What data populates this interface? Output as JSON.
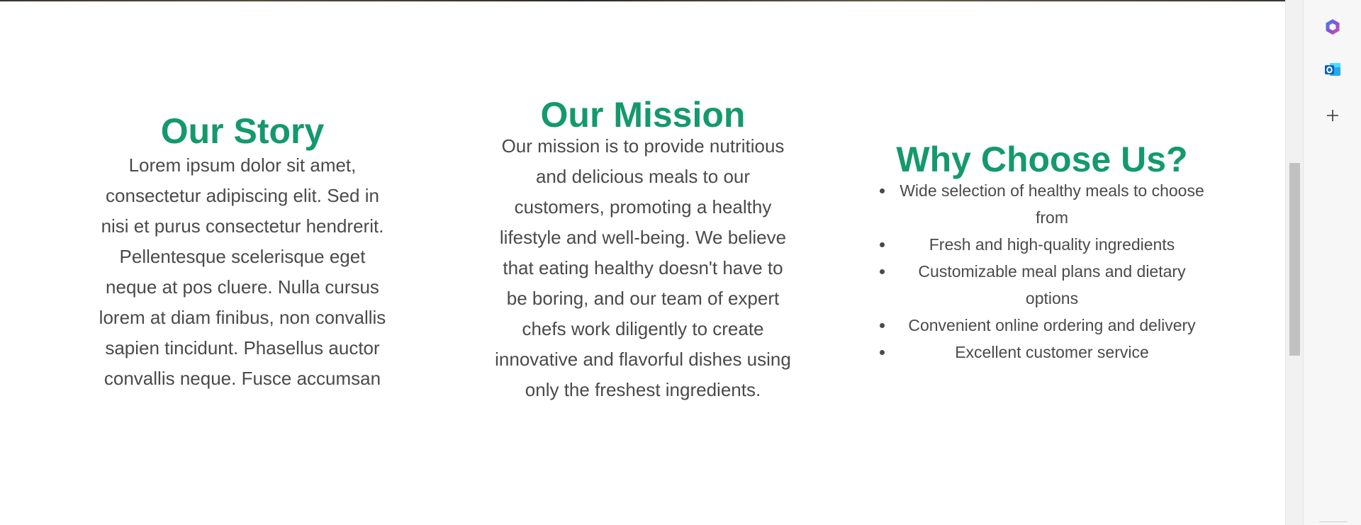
{
  "story": {
    "title": "Our Story",
    "text": "Lorem ipsum dolor sit amet, consectetur adipiscing elit. Sed in nisi et purus consectetur hendrerit. Pellentesque scelerisque eget neque at pos cluere. Nulla cursus lorem at diam finibus, non convallis sapien tincidunt. Phasellus auctor convallis neque. Fusce accumsan"
  },
  "mission": {
    "title": "Our Mission",
    "text": "Our mission is to provide nutritious and delicious meals to our customers, promoting a healthy lifestyle and well-being. We believe that eating healthy doesn't have to be boring, and our team of expert chefs work diligently to create innovative and flavorful dishes using only the freshest ingredients."
  },
  "why": {
    "title": "Why Choose Us?",
    "items": [
      "Wide selection of healthy meals to choose from",
      "Fresh and high-quality ingredients",
      "Customizable meal plans and dietary options",
      "Convenient online ordering and delivery",
      "Excellent customer service"
    ]
  },
  "sidebar": {
    "buttons": [
      {
        "icon": "copilot-icon"
      },
      {
        "icon": "outlook-icon"
      },
      {
        "icon": "add-icon"
      }
    ]
  },
  "colors": {
    "heading": "#14996d",
    "body_text": "#4a4a4a",
    "background": "#ffffff"
  },
  "scroll": {
    "position_fraction": 0.31
  }
}
